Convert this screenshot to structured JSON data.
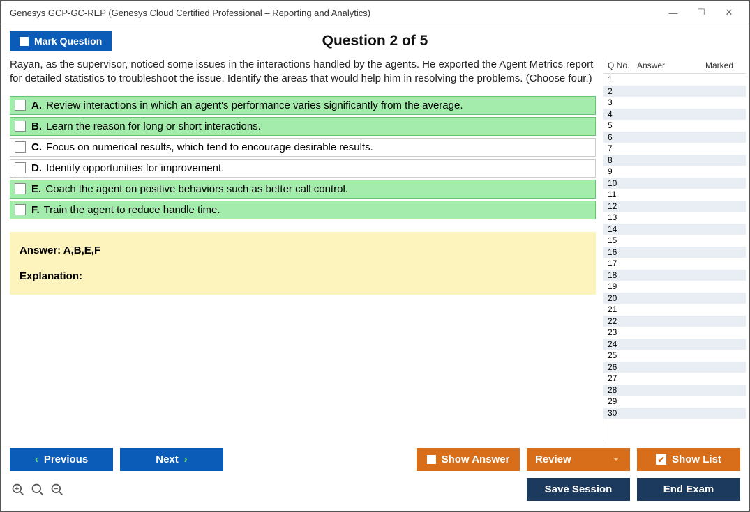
{
  "window": {
    "title": "Genesys GCP-GC-REP (Genesys Cloud Certified Professional – Reporting and Analytics)"
  },
  "header": {
    "mark_label": "Mark Question",
    "question_of": "Question 2 of 5"
  },
  "question": {
    "text": "Rayan, as the supervisor, noticed some issues in the interactions handled by the agents. He exported the Agent Metrics report for detailed statistics to troubleshoot the issue. Identify the areas that would help him in resolving the problems. (Choose four.)",
    "options": [
      {
        "letter": "A.",
        "text": "Review interactions in which an agent's performance varies significantly from the average.",
        "correct": true
      },
      {
        "letter": "B.",
        "text": "Learn the reason for long or short interactions.",
        "correct": true
      },
      {
        "letter": "C.",
        "text": "Focus on numerical results, which tend to encourage desirable results.",
        "correct": false
      },
      {
        "letter": "D.",
        "text": "Identify opportunities for improvement.",
        "correct": false
      },
      {
        "letter": "E.",
        "text": "Coach the agent on positive behaviors such as better call control.",
        "correct": true
      },
      {
        "letter": "F.",
        "text": "Train the agent to reduce handle time.",
        "correct": true
      }
    ],
    "answer_line": "Answer: A,B,E,F",
    "explanation_label": "Explanation:"
  },
  "sidepanel": {
    "headers": {
      "qno": "Q No.",
      "answer": "Answer",
      "marked": "Marked"
    },
    "rows": 30
  },
  "footer": {
    "previous": "Previous",
    "next": "Next",
    "show_answer": "Show Answer",
    "review": "Review",
    "show_list": "Show List",
    "save_session": "Save Session",
    "end_exam": "End Exam"
  }
}
